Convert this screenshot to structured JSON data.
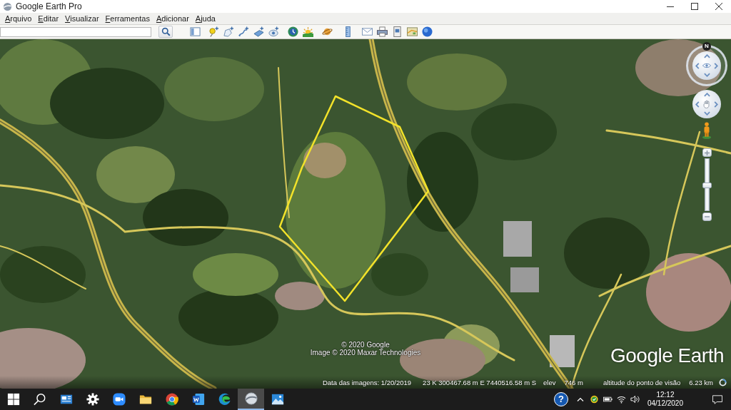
{
  "window": {
    "title": "Google Earth Pro"
  },
  "menu": [
    {
      "label": "Arquivo"
    },
    {
      "label": "Editar"
    },
    {
      "label": "Visualizar"
    },
    {
      "label": "Ferramentas"
    },
    {
      "label": "Adicionar"
    },
    {
      "label": "Ajuda"
    }
  ],
  "map": {
    "compass_label": "N",
    "zoom_slider": {
      "level": 0.5
    },
    "copyright": [
      "© 2020 Google",
      "Image © 2020 Maxar Technologies"
    ],
    "logo": "Google Earth"
  },
  "status_bar": {
    "image_date": "Data das imagens: 1/20/2019",
    "coordinates": "23 K 300467.68 m E 7440516.58 m S",
    "elevation_label": "elev",
    "elevation": "746 m",
    "eye_altitude_label": "altitude do ponto de visão",
    "eye_altitude": "6.23 km"
  },
  "taskbar": {
    "items": [
      {
        "kind": "start",
        "selected": false
      },
      {
        "kind": "search",
        "selected": false
      },
      {
        "kind": "news",
        "selected": false
      },
      {
        "kind": "settings",
        "selected": false
      },
      {
        "kind": "video",
        "selected": false
      },
      {
        "kind": "folder",
        "selected": false
      },
      {
        "kind": "browser",
        "selected": false
      },
      {
        "kind": "document",
        "selected": false
      },
      {
        "kind": "edge",
        "selected": false
      },
      {
        "kind": "earth",
        "selected": true
      },
      {
        "kind": "photos",
        "selected": false
      }
    ],
    "help": "?",
    "clock": {
      "time": "12:12",
      "date": "04/12/2020"
    }
  }
}
